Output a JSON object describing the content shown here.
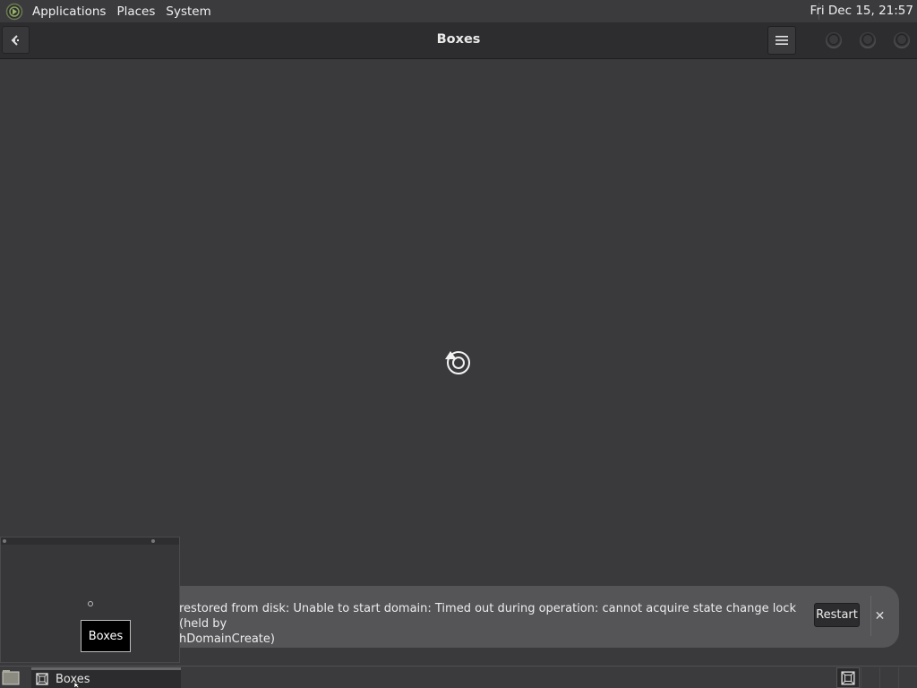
{
  "top_panel": {
    "menus": [
      "Applications",
      "Places",
      "System"
    ],
    "clock": "Fri Dec 15, 21:57"
  },
  "headerbar": {
    "title": "Boxes",
    "back_icon": "back-arrow-icon",
    "menu_icon": "hamburger-menu-icon"
  },
  "main": {
    "status_icon": "loading-spinner-icon"
  },
  "notification": {
    "message": "restored from disk: Unable to start domain: Timed out during operation: cannot acquire state change lock (held by",
    "message_line2": "hDomainCreate)",
    "restart_label": "Restart",
    "close_label": "✕"
  },
  "thumbnail": {
    "label": "Boxes"
  },
  "taskbar": {
    "task_label": "Boxes"
  },
  "colors": {
    "panel": "#3b3b3e",
    "headerbar": "#2d2d30",
    "content": "#3a3a3d",
    "notification": "#555558"
  }
}
